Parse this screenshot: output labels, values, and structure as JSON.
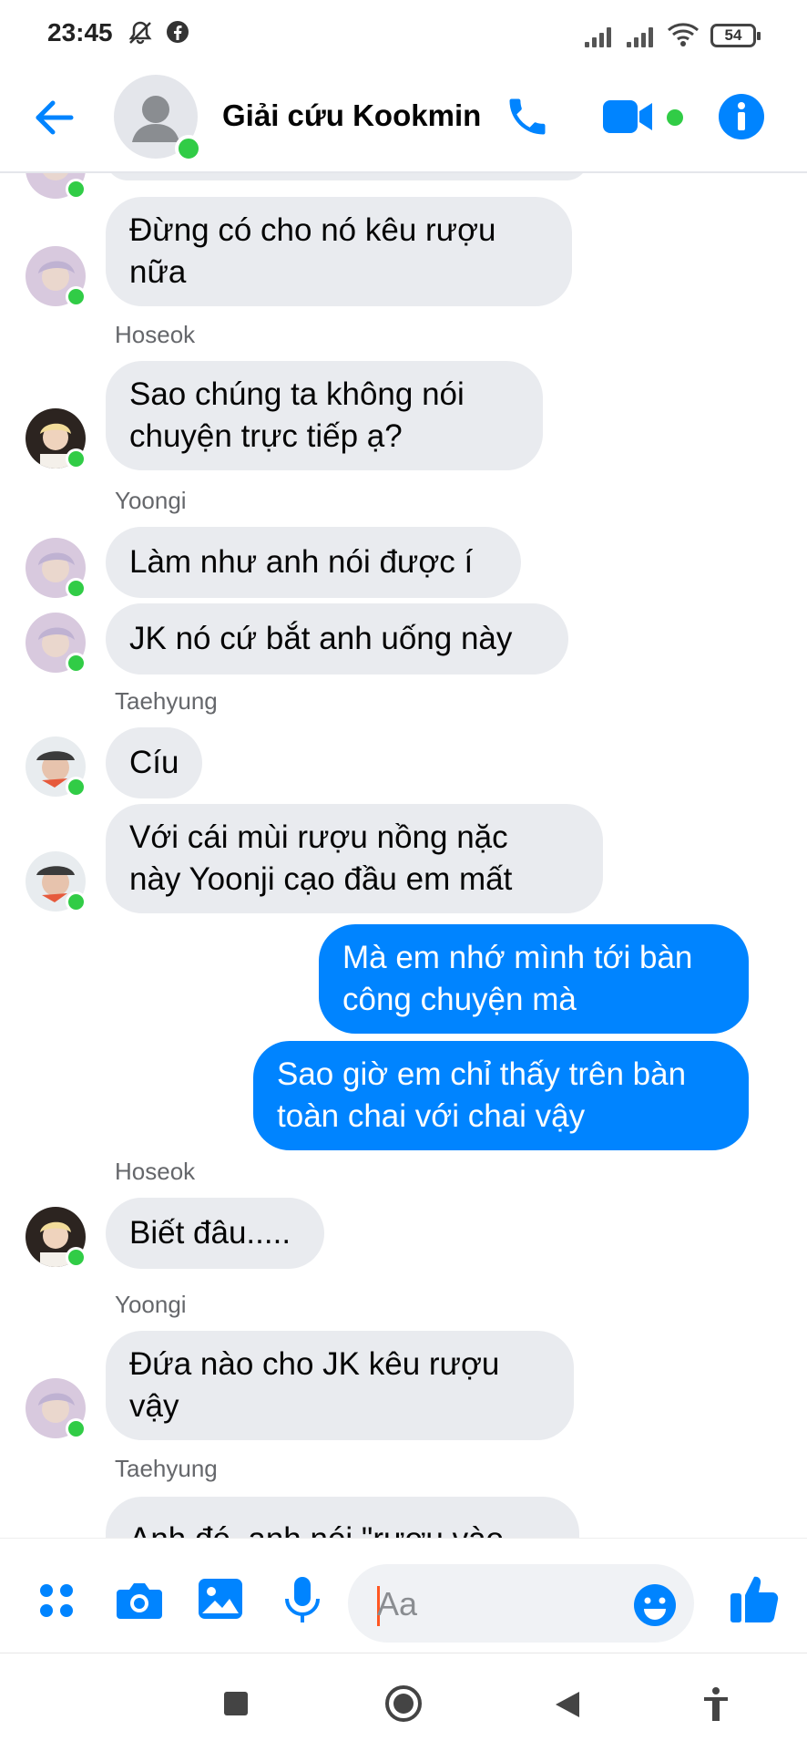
{
  "status_bar": {
    "time": "23:45",
    "battery": "54"
  },
  "header": {
    "title": "Giải cứu Kookmin"
  },
  "messages": [
    {
      "sender": "Hoseok",
      "bubbles": [
        "Sao chúng ta không nói\nchuyện trực tiếp ạ?"
      ]
    },
    {
      "sender": "Yoongi",
      "bubbles": [
        "Làm như anh nói được í",
        "JK nó cứ bắt anh uống này"
      ]
    },
    {
      "sender": "Taehyung",
      "bubbles": [
        "Cíu",
        "Với cái mùi rượu nồng nặc\nnày Yoonji cạo đầu em mất"
      ]
    },
    {
      "sender": "me",
      "bubbles": [
        "Mà em nhớ mình tới bàn\ncông chuyện mà",
        "Sao giờ em chỉ thấy trên bàn\ntoàn chai với chai vậy"
      ]
    },
    {
      "sender": "Hoseok",
      "bubbles": [
        "Biết đâu....."
      ]
    },
    {
      "sender": "Yoongi",
      "bubbles": [
        "Đứa nào cho JK kêu rượu\nvậy"
      ]
    },
    {
      "sender": "Taehyung",
      "bubbles": [
        "Anh đó, anh nói \"rượu vào"
      ]
    }
  ],
  "top_partial": "Đừng có cho nó kêu rượu\nnữa",
  "composer": {
    "placeholder": "Aa"
  },
  "colors": {
    "accent": "#0084ff",
    "online": "#31cc46",
    "bubble": "#e9ebef"
  }
}
